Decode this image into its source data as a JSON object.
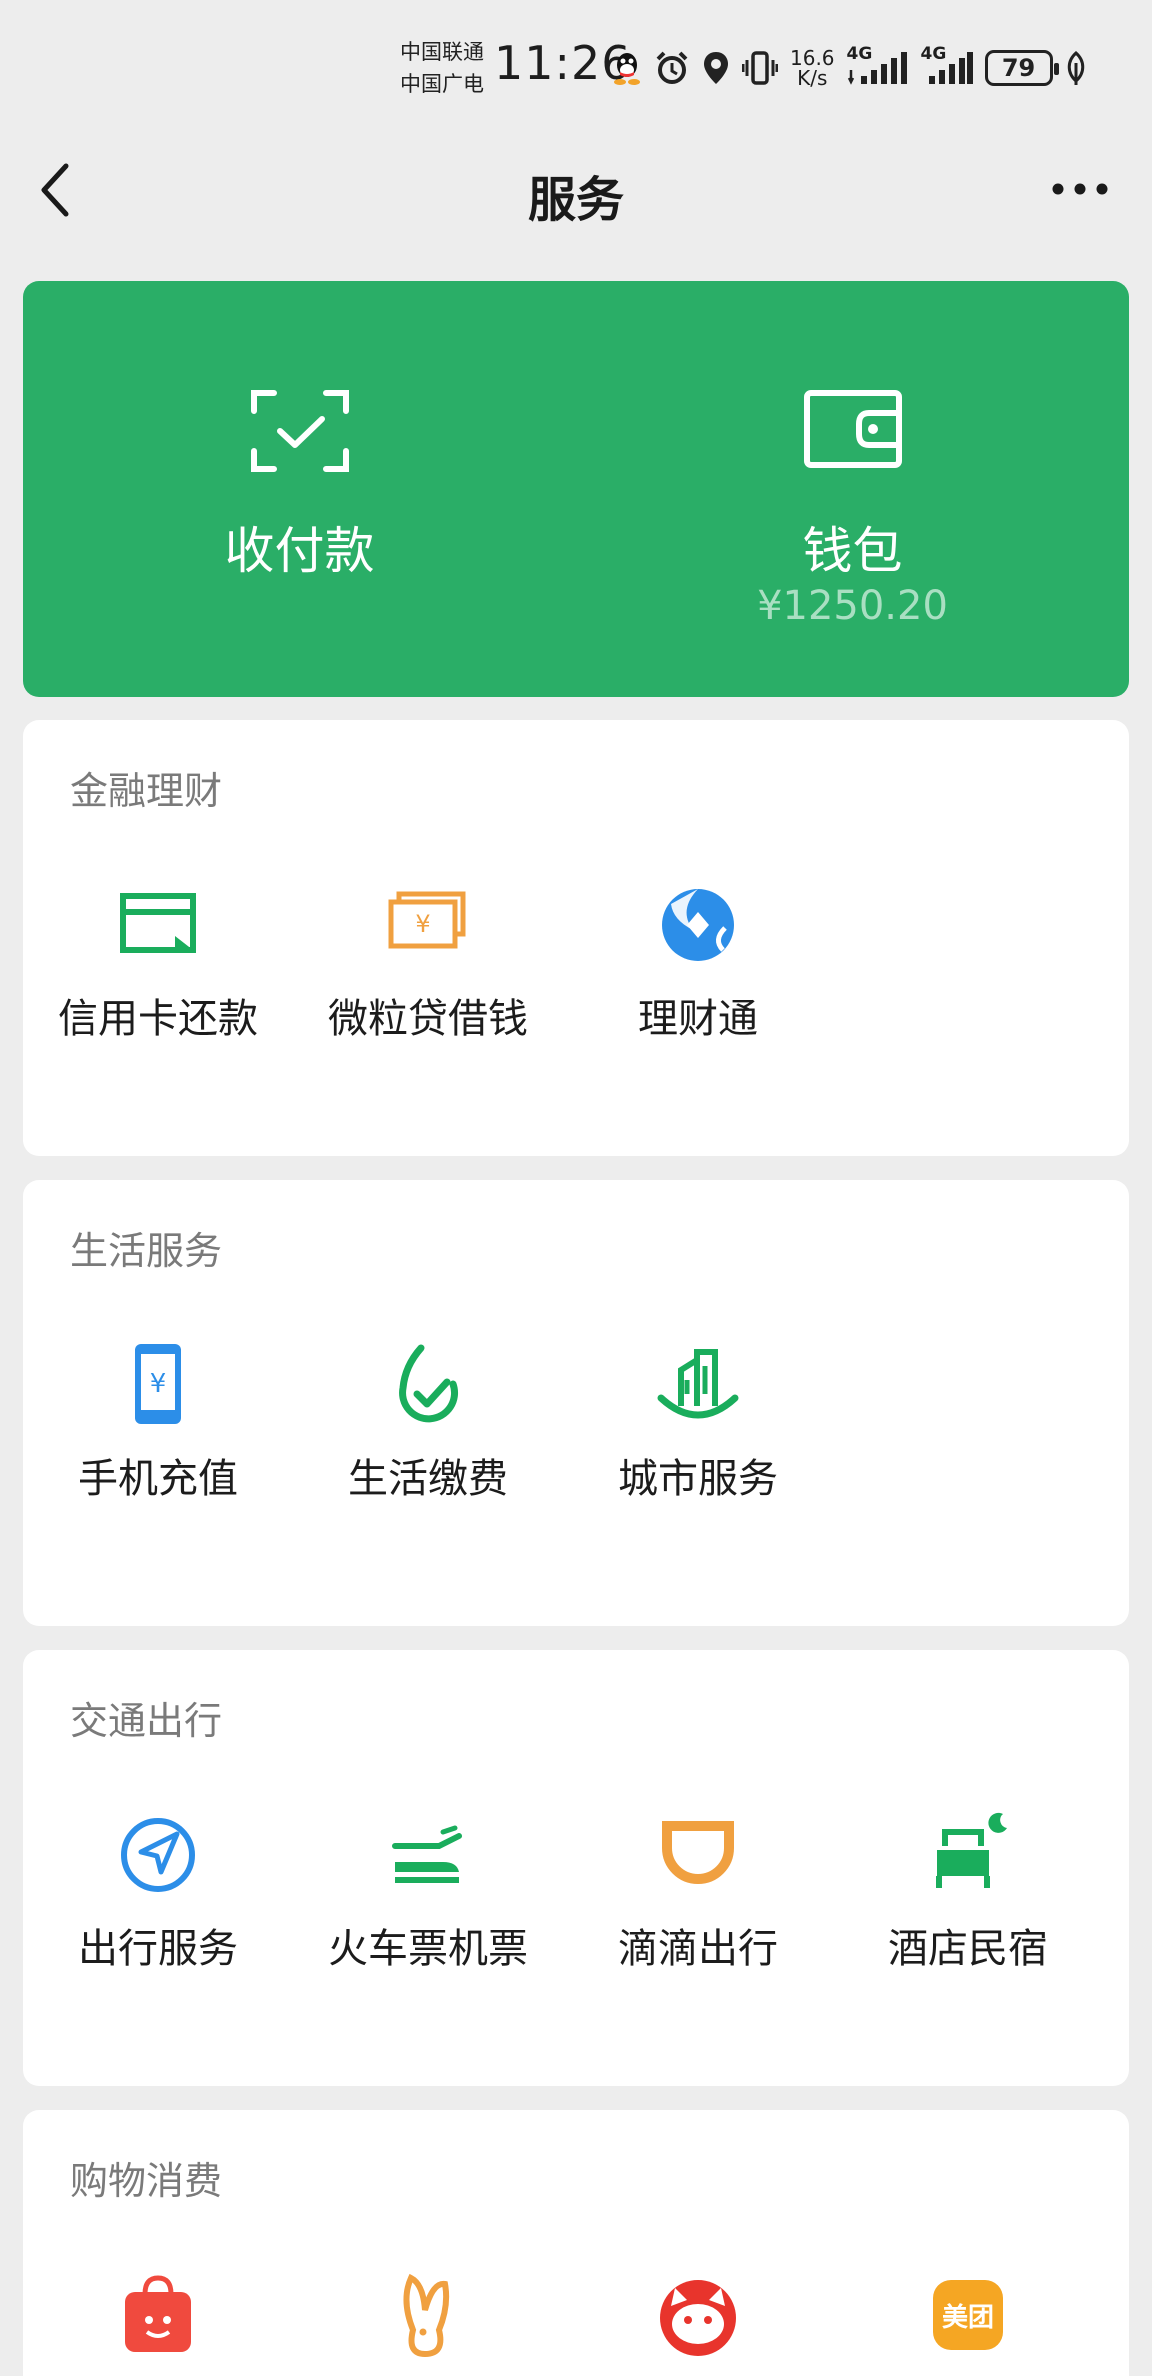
{
  "status_bar": {
    "carrier_1": "中国联通",
    "carrier_2": "中国广电",
    "time": "11:26",
    "net_speed_value": "16.6",
    "net_speed_unit": "K/s",
    "network_1": "4G",
    "network_2": "4G",
    "battery": "79",
    "icons": [
      "qq-icon",
      "alarm-icon",
      "location-icon",
      "vibrate-icon",
      "signal-icon",
      "signal-icon",
      "leaf-icon"
    ]
  },
  "navbar": {
    "title": "服务",
    "back_icon": "chevron-left-icon",
    "more_icon": "more-dots-icon"
  },
  "pay_card": {
    "color": "#2aae67",
    "pay": {
      "label": "收付款",
      "icon": "scan-check-icon"
    },
    "wallet": {
      "label": "钱包",
      "balance": "¥1250.20",
      "icon": "wallet-icon"
    }
  },
  "sections": [
    {
      "title": "金融理财",
      "items": [
        {
          "label": "信用卡还款",
          "icon": "credit-card-icon",
          "color": "#1aad5c"
        },
        {
          "label": "微粒贷借钱",
          "icon": "loan-icon",
          "color": "#f0a040"
        },
        {
          "label": "理财通",
          "icon": "wealth-icon",
          "color": "#2c8ee8"
        }
      ]
    },
    {
      "title": "生活服务",
      "items": [
        {
          "label": "手机充值",
          "icon": "phone-topup-icon",
          "color": "#2c8ee8"
        },
        {
          "label": "生活缴费",
          "icon": "utility-bill-icon",
          "color": "#1aad5c"
        },
        {
          "label": "城市服务",
          "icon": "city-service-icon",
          "color": "#1aad5c"
        }
      ]
    },
    {
      "title": "交通出行",
      "items": [
        {
          "label": "出行服务",
          "icon": "navigation-icon",
          "color": "#2c8ee8"
        },
        {
          "label": "火车票机票",
          "icon": "train-plane-icon",
          "color": "#1aad5c"
        },
        {
          "label": "滴滴出行",
          "icon": "didi-icon",
          "color": "#f0a040"
        },
        {
          "label": "酒店民宿",
          "icon": "hotel-bed-icon",
          "color": "#1aad5c"
        }
      ]
    },
    {
      "title": "购物消费",
      "items": [
        {
          "label": "",
          "icon": "shopping-bag-icon",
          "color": "#f04a3e"
        },
        {
          "label": "",
          "icon": "rabbit-icon",
          "color": "#f0a040"
        },
        {
          "label": "",
          "icon": "cat-icon",
          "color": "#e8342c"
        },
        {
          "label": "",
          "icon": "meituan-icon",
          "color": "#f5a623",
          "text": "美团"
        }
      ]
    }
  ]
}
